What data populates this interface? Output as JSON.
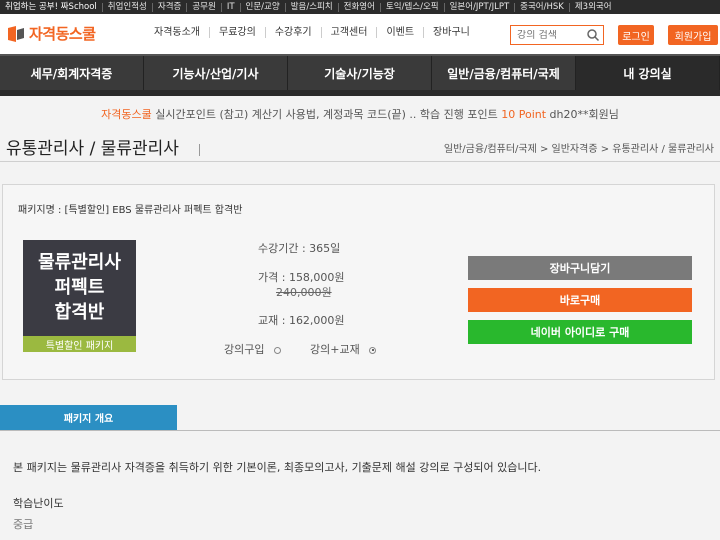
{
  "topbar": {
    "items": [
      "취업하는 공부! 짜School",
      "취업인적성",
      "자격증",
      "공무원",
      "IT",
      "인문/교양",
      "발음/스피치",
      "전화영어",
      "토익/텝스/오픽",
      "일본어/JPT/JLPT",
      "중국어/HSK",
      "제3외국어"
    ]
  },
  "header": {
    "logo_text": "자격동스쿨",
    "nav": [
      "자격동소개",
      "무료강의",
      "수강후기",
      "고객센터",
      "이벤트",
      "장바구니"
    ],
    "search_placeholder": "강의 검색",
    "login_label": "로그인",
    "join_label": "회원가입"
  },
  "menu": [
    "세무/회계자격증",
    "기능사/산업/기사",
    "기술사/기능장",
    "일반/금융/컴퓨터/국제",
    "내 강의실"
  ],
  "notice": {
    "brand": "자격동스쿨",
    "text": " 실시간포인트 (참고) 계산기 사용법, 계정과목 코드(끝) .. 학습 진행 포인트 ",
    "points": "10 Point",
    "user": " dh20**회원님"
  },
  "page": {
    "title": "유통관리사 / 물류관리사",
    "breadcrumb": "일반/금융/컴퓨터/국제 > 일반자격증 > 유통관리사 / 물류관리사"
  },
  "package": {
    "name_line": "패키지명 : [특별할인] EBS 물류관리사 퍼펙트 합격반",
    "thumb_line1": "물류관리사",
    "thumb_line2": "퍼펙트",
    "thumb_line3": "합격반",
    "thumb_band": "특별할인 패키지",
    "period": "수강기간 : 365일",
    "price": "가격 : 158,000원",
    "original_price": "240,000원",
    "textbook": "교재 : 162,000원",
    "option_lecture": "강의구입",
    "option_both": "강의+교재",
    "cart_label": "장바구니담기",
    "buy_label": "바로구매",
    "naver_label": "네이버 아이디로 구매"
  },
  "overview": {
    "tab_label": "패키지 개요",
    "description": "본 패키지는 물류관리사 자격증을 취득하기 위한 기본이론, 최종모의고사, 기출문제 해설 강의로 구성되어 있습니다.",
    "difficulty_label": "학습난이도",
    "difficulty_value": "중급"
  },
  "colors": {
    "accent": "#f26522",
    "cart": "#7a7a7a",
    "naver": "#29b82d",
    "tab": "#2b8fc3",
    "menu": "#3a3a3a"
  }
}
